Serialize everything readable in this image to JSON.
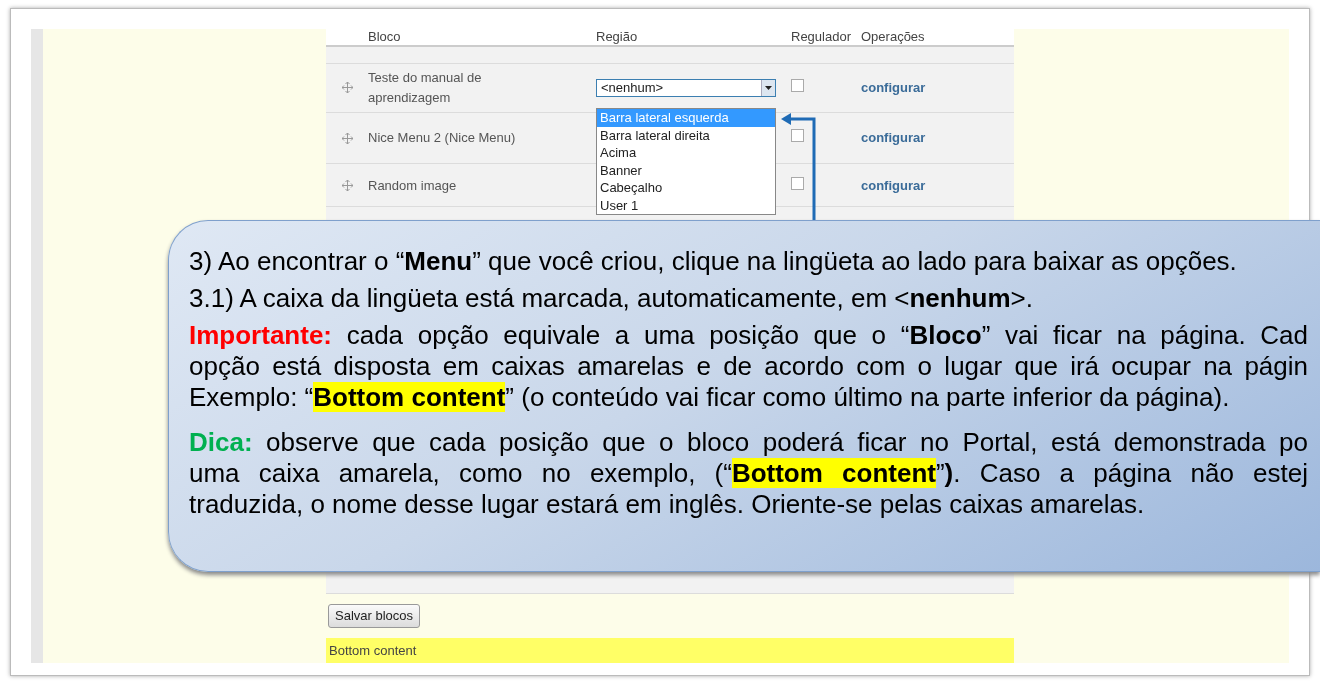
{
  "table": {
    "columns": [
      "Bloco",
      "Região",
      "Regulador",
      "Operações"
    ],
    "rows": [
      {
        "block": "Teste do manual de aprendizagem",
        "region": "<nenhum>",
        "expanded": true,
        "checked": false,
        "operation": "configurar",
        "options": [
          {
            "label": "Barra lateral esquerda",
            "selected": true
          },
          {
            "label": "Barra lateral direita",
            "selected": false
          },
          {
            "label": "Acima",
            "selected": false
          },
          {
            "label": "Banner",
            "selected": false
          },
          {
            "label": "Cabeçalho",
            "selected": false
          },
          {
            "label": "User 1",
            "selected": false
          }
        ]
      },
      {
        "block": "Nice Menu 2 (Nice Menu)",
        "checked": false,
        "operation": "configurar"
      },
      {
        "block": "Random image",
        "checked": false,
        "operation": "configurar"
      }
    ]
  },
  "save_button": "Salvar blocos",
  "region_bar": "Bottom content",
  "callout": {
    "paragraphs": [
      {
        "kind": "step",
        "lines": [
          {
            "text": "3) Ao encontrar o “**Menu**” que você criou, clique na lingüeta ao lado para baixar as opções."
          }
        ]
      },
      {
        "kind": "step",
        "lines": [
          {
            "text": "3.1) A caixa da lingüeta está marcada, automaticamente, em <**nenhum**>."
          }
        ]
      },
      {
        "kind": "important",
        "label": "Importante:",
        "lines": [
          {
            "text": "cada opção equivale a uma posição que o “**Bloco**” vai ficar na página. Cad"
          },
          {
            "text": "opção está disposta em caixas amarelas e de acordo com o lugar que irá ocupar na págin"
          },
          {
            "text": "Exemplo: “**Bottom content**” (o conteúdo vai ficar como último na parte inferior da página).",
            "highlight": true
          }
        ]
      },
      {
        "kind": "tip",
        "label": "Dica:",
        "lines": [
          {
            "text": "observe que cada posição que o bloco poderá ficar no Portal, está demonstrada po"
          },
          {
            "text": "uma caixa amarela, como no exemplo, (“**Bottom content**”**)**. Caso a página não estej",
            "highlight": true
          },
          {
            "text": "traduzida, o nome desse lugar estará em inglês. Oriente-se pelas caixas amarelas."
          }
        ]
      }
    ]
  }
}
